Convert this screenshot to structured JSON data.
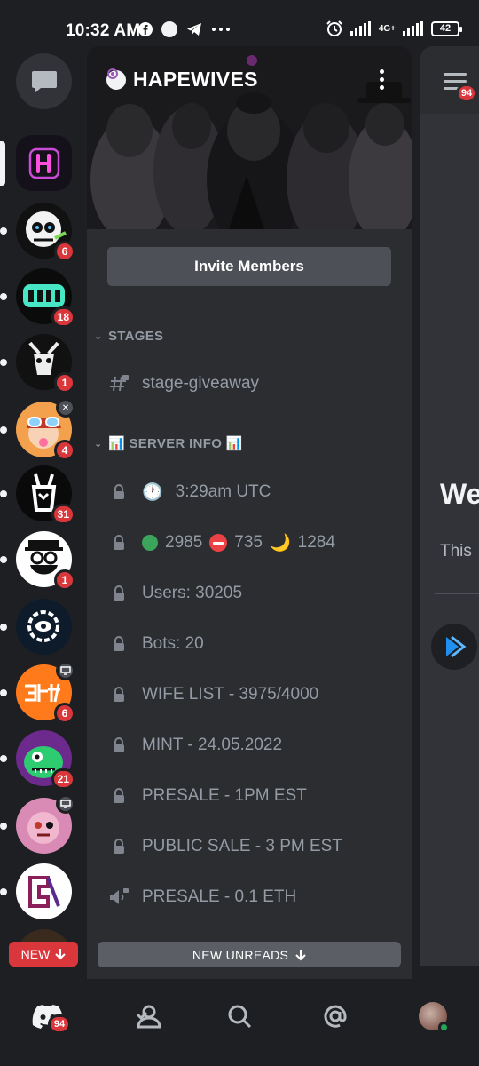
{
  "status_bar": {
    "time": "10:32 AM",
    "battery": "42",
    "network": "4G+"
  },
  "rail": {
    "servers": [
      {
        "name": "hapewives",
        "badge": ""
      },
      {
        "name": "server-2",
        "badge": "6"
      },
      {
        "name": "server-3",
        "badge": "18"
      },
      {
        "name": "server-4",
        "badge": "1"
      },
      {
        "name": "server-5",
        "badge": "4"
      },
      {
        "name": "server-6",
        "badge": "31"
      },
      {
        "name": "server-7",
        "badge": "1"
      },
      {
        "name": "server-8",
        "badge": ""
      },
      {
        "name": "server-9",
        "badge": "6"
      },
      {
        "name": "server-10",
        "badge": "21"
      },
      {
        "name": "server-11",
        "badge": ""
      },
      {
        "name": "server-12",
        "badge": ""
      }
    ],
    "new_label": "NEW"
  },
  "server": {
    "name": "HAPEWIVES",
    "invite_label": "Invite Members",
    "categories": [
      {
        "label": "STAGES"
      },
      {
        "label": "📊 SERVER INFO 📊"
      }
    ],
    "channels": [
      {
        "label": "stage-giveaway",
        "icon": "hash-lock-icon"
      },
      {
        "label": "3:29am UTC",
        "icon": "lock-icon"
      },
      {
        "label": "2985",
        "icon": "lock-icon"
      },
      {
        "label": "Users: 30205",
        "icon": "lock-icon"
      },
      {
        "label": "Bots: 20",
        "icon": "lock-icon"
      },
      {
        "label": "WIFE LIST - 3975/4000",
        "icon": "lock-icon"
      },
      {
        "label": "MINT - 24.05.2022",
        "icon": "lock-icon"
      },
      {
        "label": "PRESALE - 1PM EST",
        "icon": "lock-icon"
      },
      {
        "label": "PUBLIC SALE - 3 PM EST",
        "icon": "lock-icon"
      },
      {
        "label": "PRESALE - 0.1 ETH",
        "icon": "speaker-lock-icon"
      }
    ],
    "status_counts": {
      "online": "2985",
      "dnd": "735",
      "idle": "1284"
    },
    "new_unreads_label": "NEW UNREADS"
  },
  "peek": {
    "badge": "94",
    "heading": "We",
    "subtext": "This"
  },
  "bottom_nav": {
    "home_badge": "94"
  },
  "colors": {
    "background": "#1e1f22",
    "panel": "#2b2d31",
    "badge_red": "#da373c",
    "muted_text": "#949ba4"
  }
}
